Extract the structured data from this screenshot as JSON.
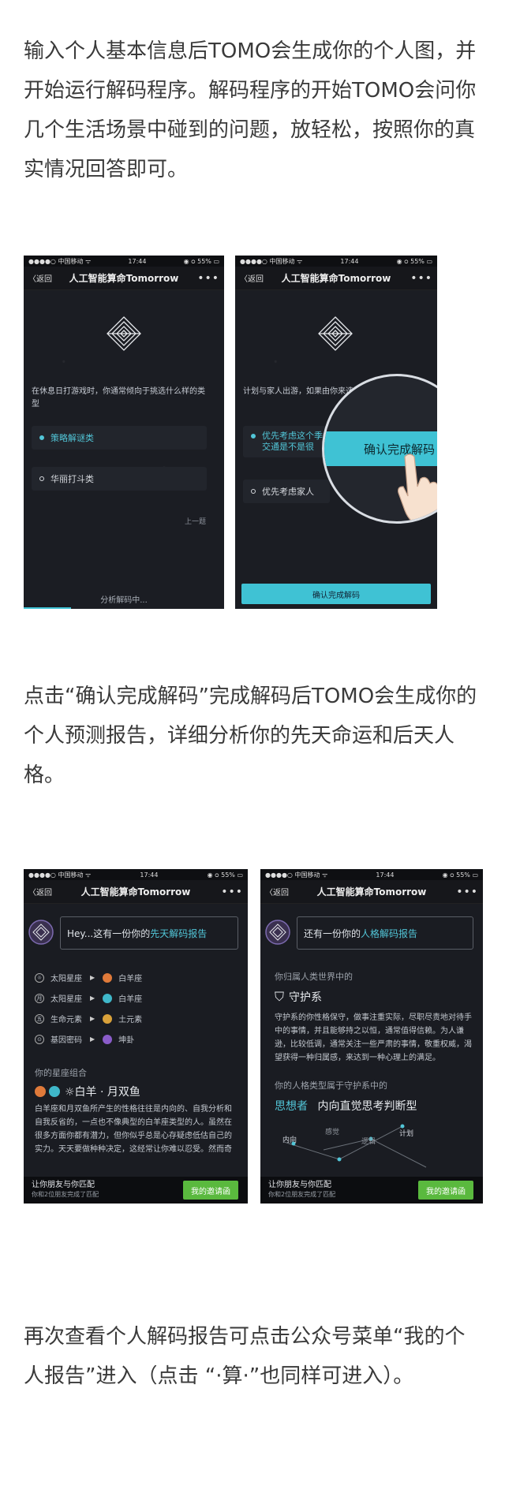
{
  "paragraphs": {
    "p1": "输入个人基本信息后TOMO会生成你的个人图，并开始运行解码程序。解码程序的开始TOMO会问你几个生活场景中碰到的问题，放轻松，按照你的真实情况回答即可。",
    "p2": "点击“确认完成解码”完成解码后TOMO会生成你的个人预测报告，详细分析你的先天命运和后天人格。",
    "p3": "再次查看个人解码报告可点击公众号菜单“我的个人报告”进入（点击 “·算·”也同样可进入）。"
  },
  "phone": {
    "carrier": "●●●●○ 中国移动 ᯤ",
    "time": "17:44",
    "battery": "◉ ᴑ 55% ▭",
    "back": "〈返回",
    "title": "人工智能算命Tomorrow",
    "more": "•••"
  },
  "screen1": {
    "question": "在休息日打游戏时，你通常倾向于挑选什么样的类型",
    "option_a": "策略解谜类",
    "option_b": "华丽打斗类",
    "prev": "上一题",
    "status": "分析解码中..."
  },
  "screen2": {
    "question": "计划与家人出游，如果由你来选择目的地，你会",
    "option_a": "优先考虑这个季",
    "option_a2": "交通是不是很",
    "option_b": "优先考虑家人",
    "magnified_button": "确认完成解码",
    "confirm_button": "确认完成解码"
  },
  "screen3": {
    "bubble_prefix": "Hey...这有一份你的",
    "bubble_highlight": "先天解码报告",
    "rows": [
      {
        "icon": "☼",
        "label": "太阳星座",
        "value": "白羊座",
        "color": "#e07a3a"
      },
      {
        "icon": "月",
        "label": "太阳星座",
        "value": "白羊座",
        "color": "#3fb7c9"
      },
      {
        "icon": "五",
        "label": "生命元素",
        "value": "土元素",
        "color": "#d9a13a"
      },
      {
        "icon": "⊙",
        "label": "基因密码",
        "value": "坤卦",
        "color": "#8a5cc9"
      }
    ],
    "section_label": "你的星座组合",
    "combo": "☼白羊 · 月双鱼",
    "body": "白羊座和月双鱼所产生的性格往往是内向的、自我分析和自我反省的，一点也不像典型的白羊座类型的人。虽然在很多方面你都有潜力，但你似乎总是心存疑虑低估自己的实力。天天要做种种决定，这经常让你难以忍受。然而奇",
    "invite_title": "让你朋友与你匹配",
    "invite_sub": "你和2位朋友完成了匹配",
    "invite_button": "我的邀请函"
  },
  "screen4": {
    "bubble_prefix": "还有一份你的",
    "bubble_highlight": "人格解码报告",
    "section_label": "你归属人类世界中的",
    "group_name": "守护系",
    "body": "守护系的你性格保守，做事注重实际，尽职尽责地对待手中的事情，并且能够持之以恒，通常值得信赖。为人谦逊，比较低调，通常关注一些严肃的事情，敬重权威，渴望获得一种归属感，来达到一种心理上的满足。",
    "type_label": "你的人格类型属于守护系中的",
    "type_name": "思想者",
    "type_desc": "内向直觉思考判断型",
    "axes": [
      "内向",
      "感觉",
      "逻辑",
      "计划"
    ],
    "invite_title": "让你朋友与你匹配",
    "invite_sub": "你和2位朋友完成了匹配",
    "invite_button": "我的邀请函"
  }
}
